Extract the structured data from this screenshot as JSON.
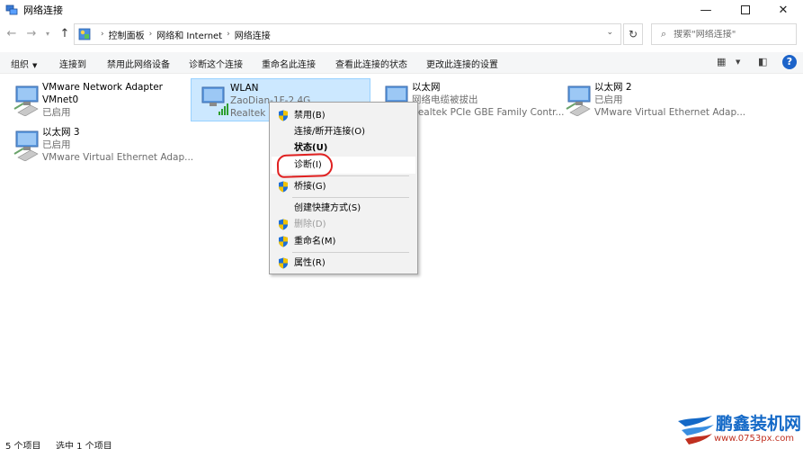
{
  "window": {
    "title": "网络连接",
    "controls": {
      "minimize": "—",
      "close": "✕"
    }
  },
  "address": {
    "breadcrumbs": [
      "控制面板",
      "网络和 Internet",
      "网络连接"
    ],
    "search_placeholder": "搜索\"网络连接\""
  },
  "commands": {
    "organize": "组织",
    "connect_to": "连接到",
    "disable": "禁用此网络设备",
    "diagnose": "诊断这个连接",
    "rename": "重命名此连接",
    "view_status": "查看此连接的状态",
    "change_settings": "更改此连接的设置",
    "help": "?"
  },
  "connections": [
    {
      "name": "VMware Network Adapter",
      "line2": "VMnet0",
      "line3": "已启用",
      "type": "ethernet"
    },
    {
      "name": "WLAN",
      "line2": "ZaoDian-1F-2.4G",
      "line3": "Realtek 8",
      "type": "wifi",
      "selected": true
    },
    {
      "name": "以太网",
      "line2": "网络电缆被拔出",
      "line3": "Realtek PCIe GBE Family Contr...",
      "type": "ethernet-unplugged"
    },
    {
      "name": "以太网 2",
      "line2": "已启用",
      "line3": "VMware Virtual Ethernet Adap...",
      "type": "ethernet"
    },
    {
      "name": "以太网 3",
      "line2": "已启用",
      "line3": "VMware Virtual Ethernet Adap...",
      "type": "ethernet"
    }
  ],
  "context_menu": {
    "disable": "禁用(B)",
    "connect_disconnect": "连接/断开连接(O)",
    "status": "状态(U)",
    "diagnose": "诊断(I)",
    "bridge": "桥接(G)",
    "create_shortcut": "创建快捷方式(S)",
    "delete": "删除(D)",
    "rename": "重命名(M)",
    "properties": "属性(R)"
  },
  "status_bar": {
    "item_count": "5 个项目",
    "selected_count": "选中 1 个项目"
  },
  "watermark": {
    "brand": "鹏鑫装机网",
    "url": "www.0753px.com"
  },
  "colors": {
    "selection_bg": "#cce8ff",
    "selection_border": "#99d1ff",
    "annotation_red": "#e02020",
    "help_blue": "#1c63c9",
    "watermark_blue": "#1469c7",
    "watermark_red": "#c03020"
  }
}
